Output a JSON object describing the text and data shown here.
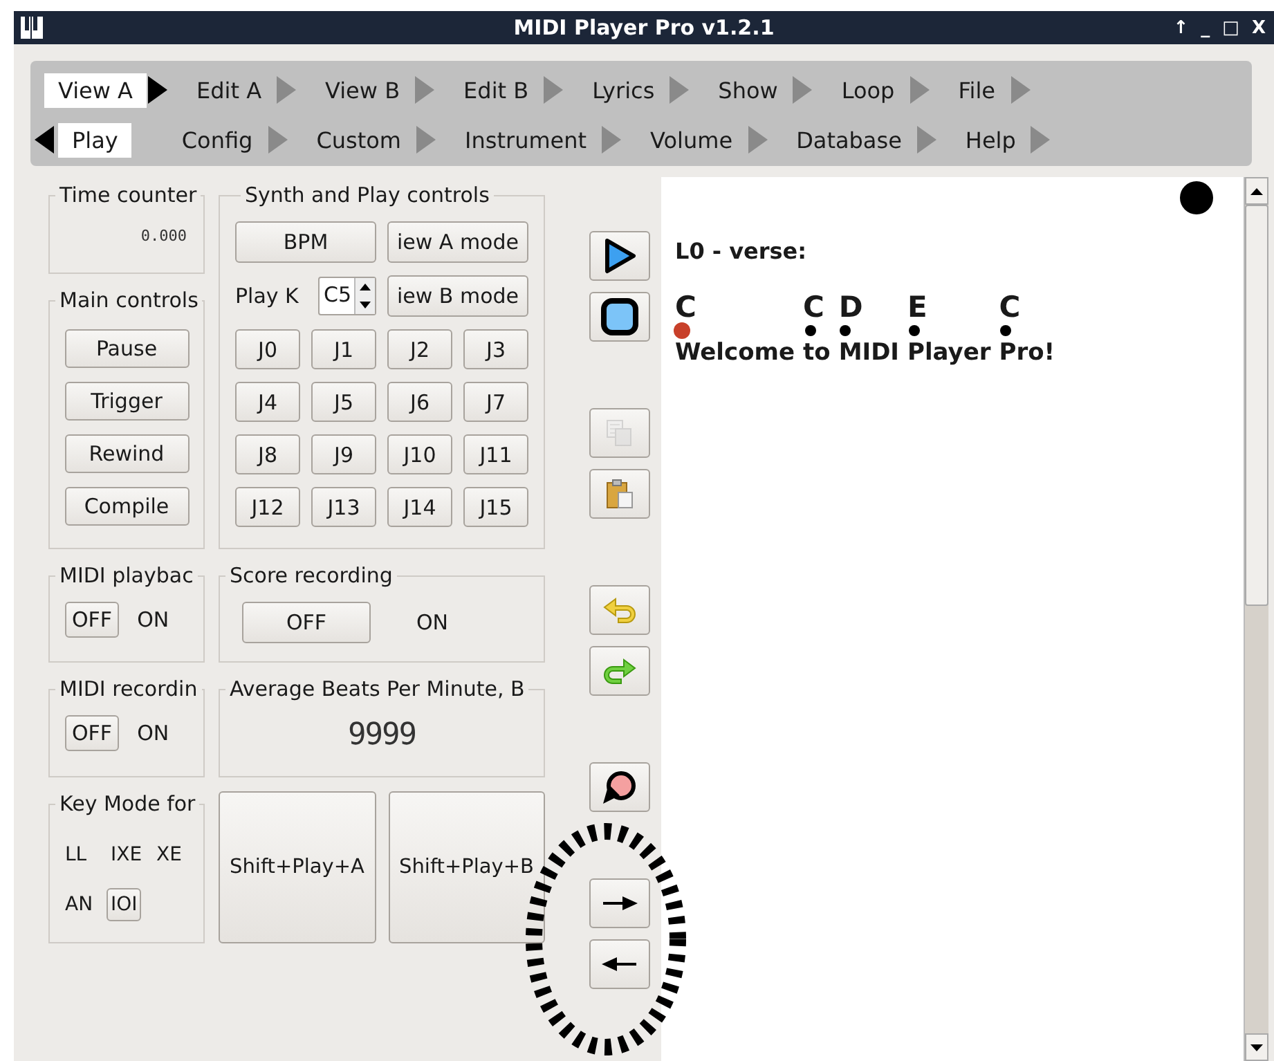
{
  "window": {
    "title": "MIDI Player Pro v1.2.1",
    "controls": [
      "↑",
      "_",
      "□",
      "X"
    ]
  },
  "tab_rows": [
    [
      {
        "label": "View A",
        "selected": true,
        "kind": "right"
      },
      {
        "label": "Edit A",
        "selected": false,
        "kind": "right"
      },
      {
        "label": "View B",
        "selected": false,
        "kind": "right"
      },
      {
        "label": "Edit B",
        "selected": false,
        "kind": "right"
      },
      {
        "label": "Lyrics",
        "selected": false,
        "kind": "right"
      },
      {
        "label": "Show",
        "selected": false,
        "kind": "right"
      },
      {
        "label": "Loop",
        "selected": false,
        "kind": "right"
      },
      {
        "label": "File",
        "selected": false,
        "kind": "right"
      }
    ],
    [
      {
        "label": "Play",
        "selected": true,
        "kind": "left"
      },
      {
        "label": "Config",
        "selected": false,
        "kind": "right"
      },
      {
        "label": "Custom",
        "selected": false,
        "kind": "right"
      },
      {
        "label": "Instrument",
        "selected": false,
        "kind": "right"
      },
      {
        "label": "Volume",
        "selected": false,
        "kind": "right"
      },
      {
        "label": "Database",
        "selected": false,
        "kind": "right"
      },
      {
        "label": "Help",
        "selected": false,
        "kind": "right"
      }
    ]
  ],
  "time_counter": {
    "title": "Time counter",
    "value": "0.000"
  },
  "main_controls": {
    "title": "Main controls",
    "buttons": [
      "Pause",
      "Trigger",
      "Rewind",
      "Compile"
    ]
  },
  "synth": {
    "title": "Synth and Play controls",
    "bpm_button": "BPM",
    "view_a_button": "iew A mode",
    "play_key_label": "Play K",
    "play_key_value": "C5",
    "view_b_button": "iew B mode",
    "j_buttons": [
      "J0",
      "J1",
      "J2",
      "J3",
      "J4",
      "J5",
      "J6",
      "J7",
      "J8",
      "J9",
      "J10",
      "J11",
      "J12",
      "J13",
      "J14",
      "J15"
    ]
  },
  "midi_playback": {
    "title": "MIDI playbac",
    "options": [
      {
        "label": "OFF",
        "selected": true
      },
      {
        "label": "ON",
        "selected": false
      }
    ]
  },
  "score_recording": {
    "title": "Score recording",
    "options": [
      {
        "label": "OFF",
        "selected": true
      },
      {
        "label": "ON",
        "selected": false
      }
    ]
  },
  "midi_recording": {
    "title": "MIDI recordin",
    "options": [
      {
        "label": "OFF",
        "selected": true
      },
      {
        "label": "ON",
        "selected": false
      }
    ]
  },
  "average_bpm": {
    "title": "Average Beats Per Minute, B",
    "value": "9999"
  },
  "key_mode": {
    "title": "Key Mode for",
    "options": [
      {
        "label": "LL",
        "selected": false
      },
      {
        "label": "IXE",
        "selected": false
      },
      {
        "label": "XE",
        "selected": false
      },
      {
        "label": "AN",
        "selected": false
      },
      {
        "label": "IOI",
        "selected": true
      }
    ]
  },
  "shift_buttons": [
    "Shift+Play+A",
    "Shift+Play+B"
  ],
  "tools": [
    [
      {
        "kind": "play",
        "disabled": false
      },
      {
        "kind": "stop",
        "disabled": false
      }
    ],
    [
      {
        "kind": "copy",
        "disabled": true
      },
      {
        "kind": "paste",
        "disabled": false
      }
    ],
    [
      {
        "kind": "undo",
        "disabled": false
      },
      {
        "kind": "redo",
        "disabled": false
      }
    ],
    [
      {
        "kind": "loop",
        "disabled": false
      }
    ],
    [
      {
        "kind": "next",
        "disabled": false
      },
      {
        "kind": "previous",
        "disabled": false
      }
    ]
  ],
  "lyrics": {
    "heading": "L0 - verse:",
    "words": [
      {
        "text": "Welcome",
        "note": "C",
        "current": true
      },
      {
        "text": "to",
        "note": "C",
        "current": false
      },
      {
        "text": "MIDI",
        "note": "D",
        "current": false
      },
      {
        "text": "Player",
        "note": "E",
        "current": false
      },
      {
        "text": "Pro!",
        "note": "C",
        "current": false
      }
    ]
  }
}
